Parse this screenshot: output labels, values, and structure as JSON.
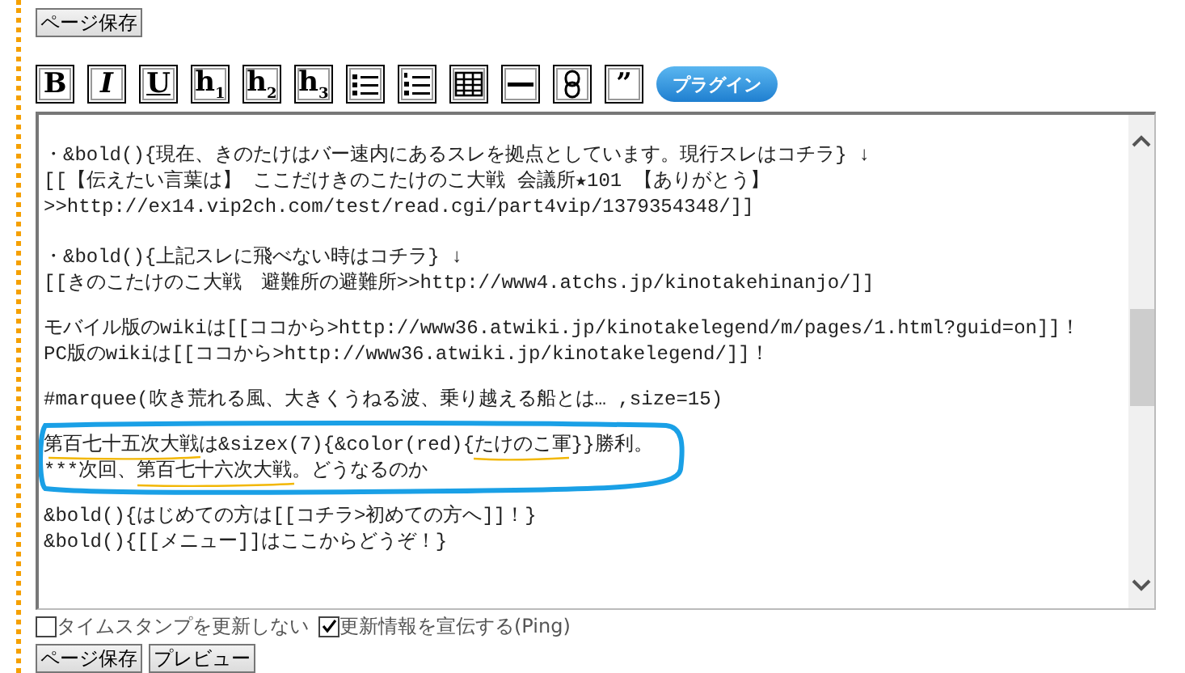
{
  "top_save_button": "ページ保存",
  "toolbar": [
    {
      "kind": "text",
      "label": "B"
    },
    {
      "kind": "text",
      "label": "I"
    },
    {
      "kind": "text",
      "label": "U"
    },
    {
      "kind": "text",
      "label": "h$_{1}$"
    },
    {
      "kind": "text",
      "label": "h$_{2}$"
    },
    {
      "kind": "text",
      "label": "h$_{3}$"
    },
    {
      "kind": "bullet-list"
    },
    {
      "kind": "numbered-list"
    },
    {
      "kind": "table"
    },
    {
      "kind": "horizontal-rule"
    },
    {
      "kind": "link"
    },
    {
      "kind": "text",
      "label": "”"
    },
    {
      "kind": "plugin",
      "label": "プラグイン"
    }
  ],
  "editor": {
    "paragraphs": [
      {
        "circled": false,
        "lines": [
          "・&bold(){現在、きのたけはバー速内にあるスレを拠点としています。現行スレはコチラ} ↓",
          "[[【伝えたい言葉は】 ここだけきのこたけのこ大戦 会議所★101 【ありがとう】",
          ">>http://ex14.vip2ch.com/test/read.cgi/part4vip/1379354348/]]"
        ]
      },
      {
        "circled": false,
        "lines": [
          "・&bold(){上記スレに飛べない時はコチラ} ↓",
          "[[きのこたけのこ大戦　避難所の避難所>>http://www4.atchs.jp/kinotakehinanjo/]]"
        ]
      },
      {
        "circled": false,
        "lines": [
          "モバイル版のwikiは[[ココから>http://www36.atwiki.jp/kinotakelegend/m/pages/1.html?guid=on]]！",
          "PC版のwikiは[[ココから>http://www36.atwiki.jp/kinotakelegend/]]！"
        ]
      },
      {
        "circled": false,
        "lines": [
          "#marquee(吹き荒れる風、大きくうねる波、乗り越える船とは… ,size=15)"
        ]
      },
      {
        "circled": true,
        "lines": [
          "第百七十五次大戦は&sizex(7){&color(red){たけのこ軍}}勝利。",
          "***次回、第百七十六次大戦。どうなるのか"
        ]
      },
      {
        "circled": false,
        "lines": [
          "&bold(){はじめての方は[[コチラ>初めての方へ]]！}",
          "&bold(){[[メニュー]]はここからどうぞ！}"
        ]
      }
    ]
  },
  "options": [
    {
      "label": "タイムスタンプを更新しない",
      "checked": false
    },
    {
      "label": "更新情報を宣伝する(Ping)",
      "checked": true
    }
  ],
  "buttons": [
    "ページ保存",
    "プレビュー"
  ]
}
